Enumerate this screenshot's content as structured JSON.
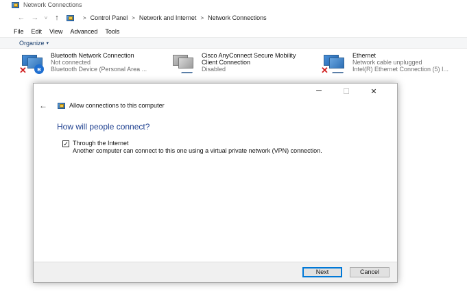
{
  "window": {
    "title": "Network Connections"
  },
  "nav": {
    "back": "←",
    "forward": "→",
    "recent": "˅",
    "up": "↑"
  },
  "breadcrumb": {
    "items": [
      "Control Panel",
      "Network and Internet",
      "Network Connections"
    ],
    "separator": ">"
  },
  "menu": {
    "items": [
      "File",
      "Edit",
      "View",
      "Advanced",
      "Tools"
    ]
  },
  "toolbar": {
    "organize": "Organize",
    "organize_caret": "▾"
  },
  "connections": [
    {
      "name": "Bluetooth Network Connection",
      "line2": "Not connected",
      "line3": "Bluetooth Device (Personal Area ...",
      "icon": "bluetooth-network-icon"
    },
    {
      "name": "Cisco AnyConnect Secure Mobility",
      "line2": "Client Connection",
      "line3": "Disabled",
      "icon": "vpn-adapter-icon"
    },
    {
      "name": "Ethernet",
      "line2": "Network cable unplugged",
      "line3": "Intel(R) Ethernet Connection (5) I...",
      "icon": "ethernet-adapter-icon"
    }
  ],
  "dialog": {
    "title": "Allow connections to this computer",
    "question": "How will people connect?",
    "option_label": "Through the Internet",
    "option_desc": "Another computer can connect to this one using a virtual private network (VPN) connection.",
    "option_checked": true,
    "next_label": "Next",
    "cancel_label": "Cancel",
    "minimize": "─",
    "maximize": "☐",
    "close": "✕",
    "back": "←",
    "check_mark": "✓"
  },
  "colors": {
    "heading_blue": "#1d3f8f",
    "accent": "#0078d7",
    "error_red": "#d11f1f"
  }
}
